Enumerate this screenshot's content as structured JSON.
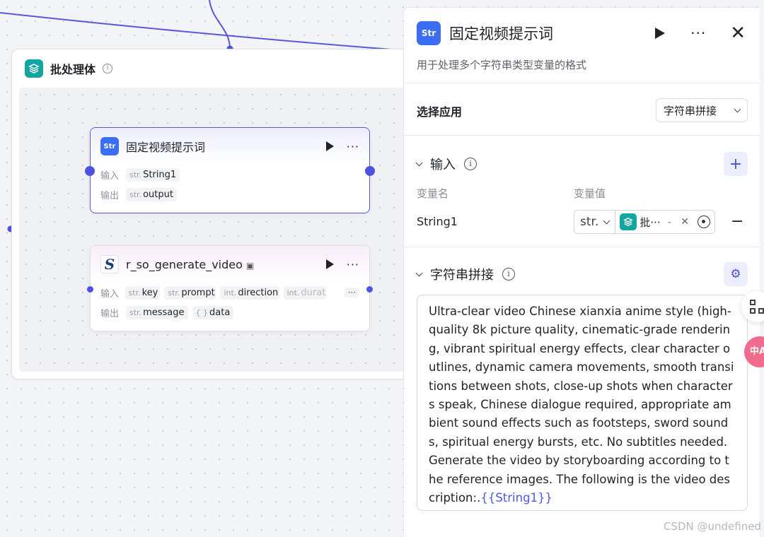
{
  "batch": {
    "title": "批处理体"
  },
  "node1": {
    "title": "固定视频提示词",
    "input_label": "输入",
    "output_label": "输出",
    "inputs": [
      {
        "type": "str.",
        "name": "String1"
      }
    ],
    "outputs": [
      {
        "type": "str.",
        "name": "output"
      }
    ]
  },
  "node2": {
    "title": "r_so_generate_video",
    "input_label": "输入",
    "output_label": "输出",
    "inputs": [
      {
        "type": "str.",
        "name": "key"
      },
      {
        "type": "str.",
        "name": "prompt"
      },
      {
        "type": "int.",
        "name": "direction"
      },
      {
        "type": "int.",
        "name": "durat"
      }
    ],
    "more": "···",
    "outputs": [
      {
        "type": "str.",
        "name": "message"
      },
      {
        "type": "{ }",
        "name": "data"
      }
    ]
  },
  "panel": {
    "title": "固定视频提示词",
    "icon_text": "Str",
    "description": "用于处理多个字符串类型变量的格式",
    "select_app_label": "选择应用",
    "select_value": "字符串拼接",
    "input_section": "输入",
    "col_var_name": "变量名",
    "col_var_value": "变量值",
    "var_name": "String1",
    "var_type": "str.",
    "var_ref": "批···",
    "var_ref_sep": "-",
    "concat_section": "字符串拼接",
    "template_text": "Ultra-clear video Chinese xianxia anime style (high-quality 8k picture quality, cinematic-grade rendering, vibrant spiritual energy effects, clear character outlines, dynamic camera movements, smooth transitions between shots, close-up shots when characters speak, Chinese dialogue required, appropriate ambient sound effects such as footsteps, sword sounds, spiritual energy bursts, etc. No subtitles needed. Generate the video by storyboarding according to the reference images. The following is the video description:.",
    "template_var": "{{String1}}"
  },
  "floating": {
    "pink_text": "中A"
  },
  "watermark": "CSDN @undefined"
}
